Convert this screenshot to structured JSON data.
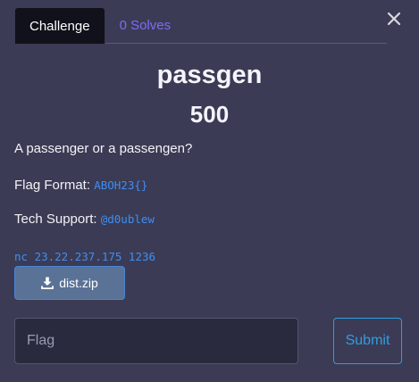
{
  "tabs": {
    "challenge_label": "Challenge",
    "solves_label": "0 Solves"
  },
  "challenge": {
    "name": "passgen",
    "points": "500",
    "description": "A passenger or a passengen?",
    "flag_format_label": "Flag Format:",
    "flag_format_value": "ABOH23{}",
    "tech_support_label": "Tech Support:",
    "tech_support_value": "@d0ublew",
    "connection": "nc 23.22.237.175 1236"
  },
  "download": {
    "label": "dist.zip",
    "icon": "download-icon"
  },
  "form": {
    "flag_placeholder": "Flag",
    "submit_label": "Submit"
  },
  "icons": {
    "close": "close-icon"
  },
  "colors": {
    "background": "#3b3b55",
    "active_tab": "#11111b",
    "inactive_tab_text": "#7e6cf2",
    "code_text": "#3f8ef2",
    "download_button": "#5a7296",
    "submit_accent": "#2f9ee3"
  }
}
